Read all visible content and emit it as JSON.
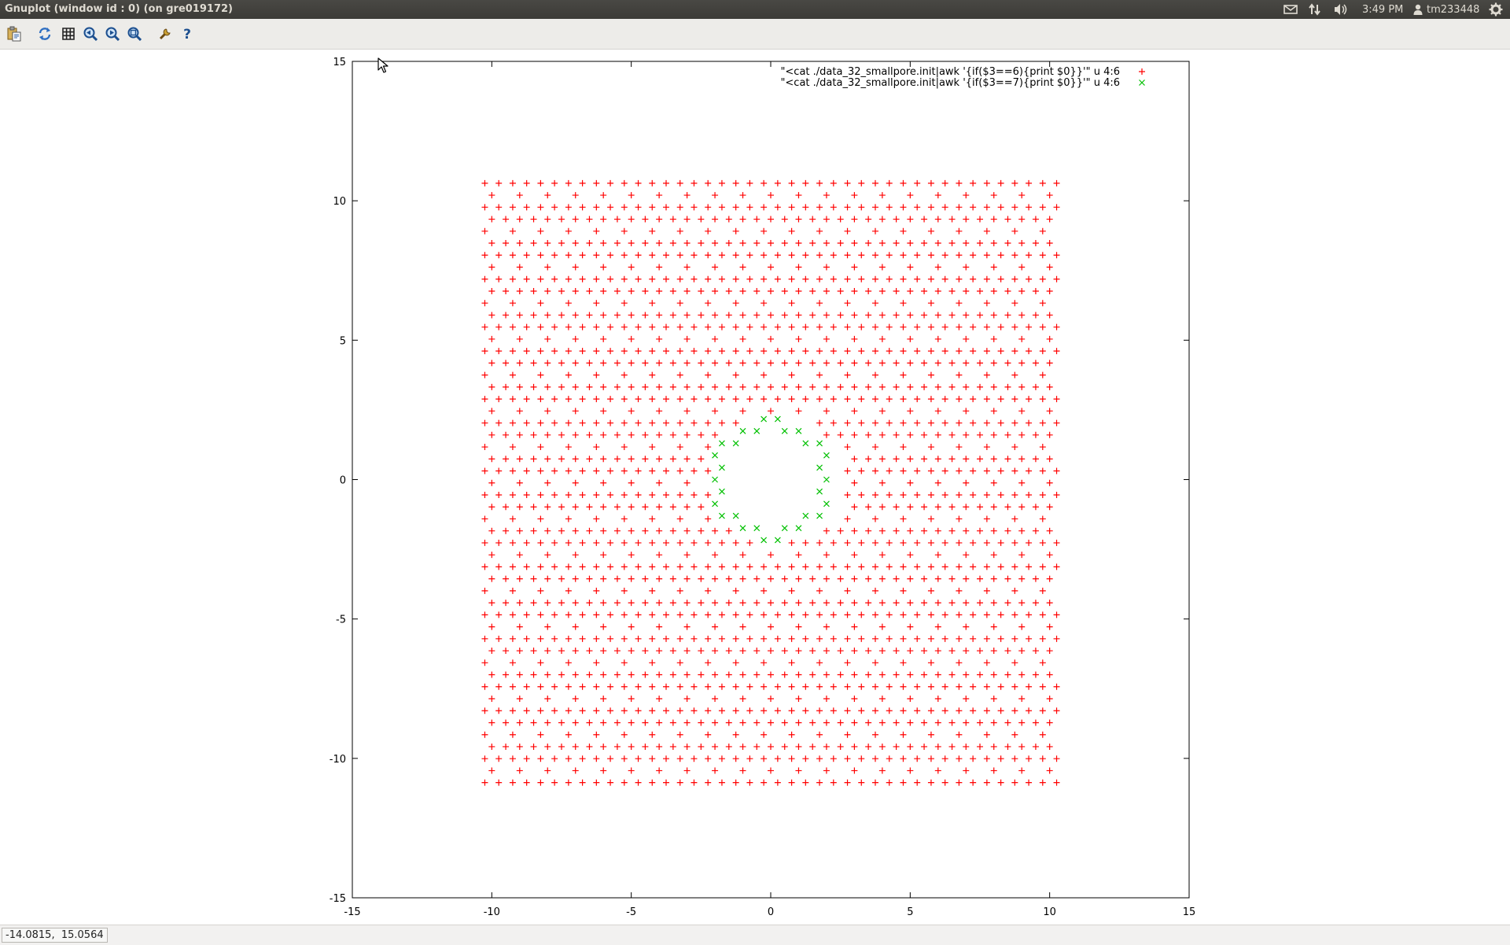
{
  "window": {
    "title": "Gnuplot (window id : 0) (on gre019172)"
  },
  "tray": {
    "time": "3:49 PM",
    "user": "tm233448",
    "icons": [
      "mail-icon",
      "network-icon",
      "volume-icon",
      "user-icon",
      "gear-icon"
    ]
  },
  "toolbar": {
    "buttons": [
      "copy-to-clipboard-icon",
      "replot-icon",
      "grid-icon",
      "zoom-previous-icon",
      "zoom-next-icon",
      "autoscale-icon",
      "options-icon",
      "help-icon"
    ]
  },
  "status": {
    "coordinates": "-14.0815,  15.0564"
  },
  "colors": {
    "series1": "#ff0000",
    "series2": "#00c000",
    "axis": "#000000",
    "titlebar": "#3c3b37"
  },
  "chart_data": {
    "type": "scatter",
    "xlim": [
      -15,
      15
    ],
    "ylim": [
      -15,
      15
    ],
    "x_ticks": [
      "-15",
      "-10",
      "-5",
      "0",
      "5",
      "10",
      "15"
    ],
    "y_ticks": [
      "-15",
      "-10",
      "-5",
      "0",
      "5",
      "10",
      "15"
    ],
    "grid": false,
    "legend_position": "top-right",
    "series": [
      {
        "name": "\"<cat ./data_32_smallpore.init|awk '{if($3==6){print $0}}'\" u 4:6",
        "marker": "+",
        "color": "#ff0000",
        "lattice": "hexagonal",
        "x_range": [
          -10.25,
          10.25
        ],
        "y_range": [
          -10.87,
          10.43
        ],
        "spacing_x": 1.0,
        "spacing_y": 0.43,
        "row_offset": 0.25,
        "approx_points": 950
      },
      {
        "name": "\"<cat ./data_32_smallpore.init|awk '{if($3==7){print $0}}'\" u 4:6",
        "marker": "x",
        "color": "#00c000",
        "points": [
          [
            -0.25,
            2.17
          ],
          [
            0.25,
            2.17
          ],
          [
            -1.0,
            1.74
          ],
          [
            -0.5,
            1.74
          ],
          [
            0.5,
            1.74
          ],
          [
            1.0,
            1.74
          ],
          [
            -1.75,
            1.3
          ],
          [
            -1.25,
            1.3
          ],
          [
            1.25,
            1.3
          ],
          [
            1.75,
            1.3
          ],
          [
            -2.0,
            0.87
          ],
          [
            2.0,
            0.87
          ],
          [
            -1.75,
            0.43
          ],
          [
            1.75,
            0.43
          ],
          [
            -2.0,
            0.0
          ],
          [
            2.0,
            0.0
          ],
          [
            -1.75,
            -0.43
          ],
          [
            1.75,
            -0.43
          ],
          [
            -2.0,
            -0.87
          ],
          [
            2.0,
            -0.87
          ],
          [
            -1.75,
            -1.3
          ],
          [
            -1.25,
            -1.3
          ],
          [
            1.25,
            -1.3
          ],
          [
            1.75,
            -1.3
          ],
          [
            -1.0,
            -1.74
          ],
          [
            -0.5,
            -1.74
          ],
          [
            0.5,
            -1.74
          ],
          [
            1.0,
            -1.74
          ],
          [
            -0.25,
            -2.17
          ],
          [
            0.25,
            -2.17
          ]
        ]
      }
    ]
  }
}
